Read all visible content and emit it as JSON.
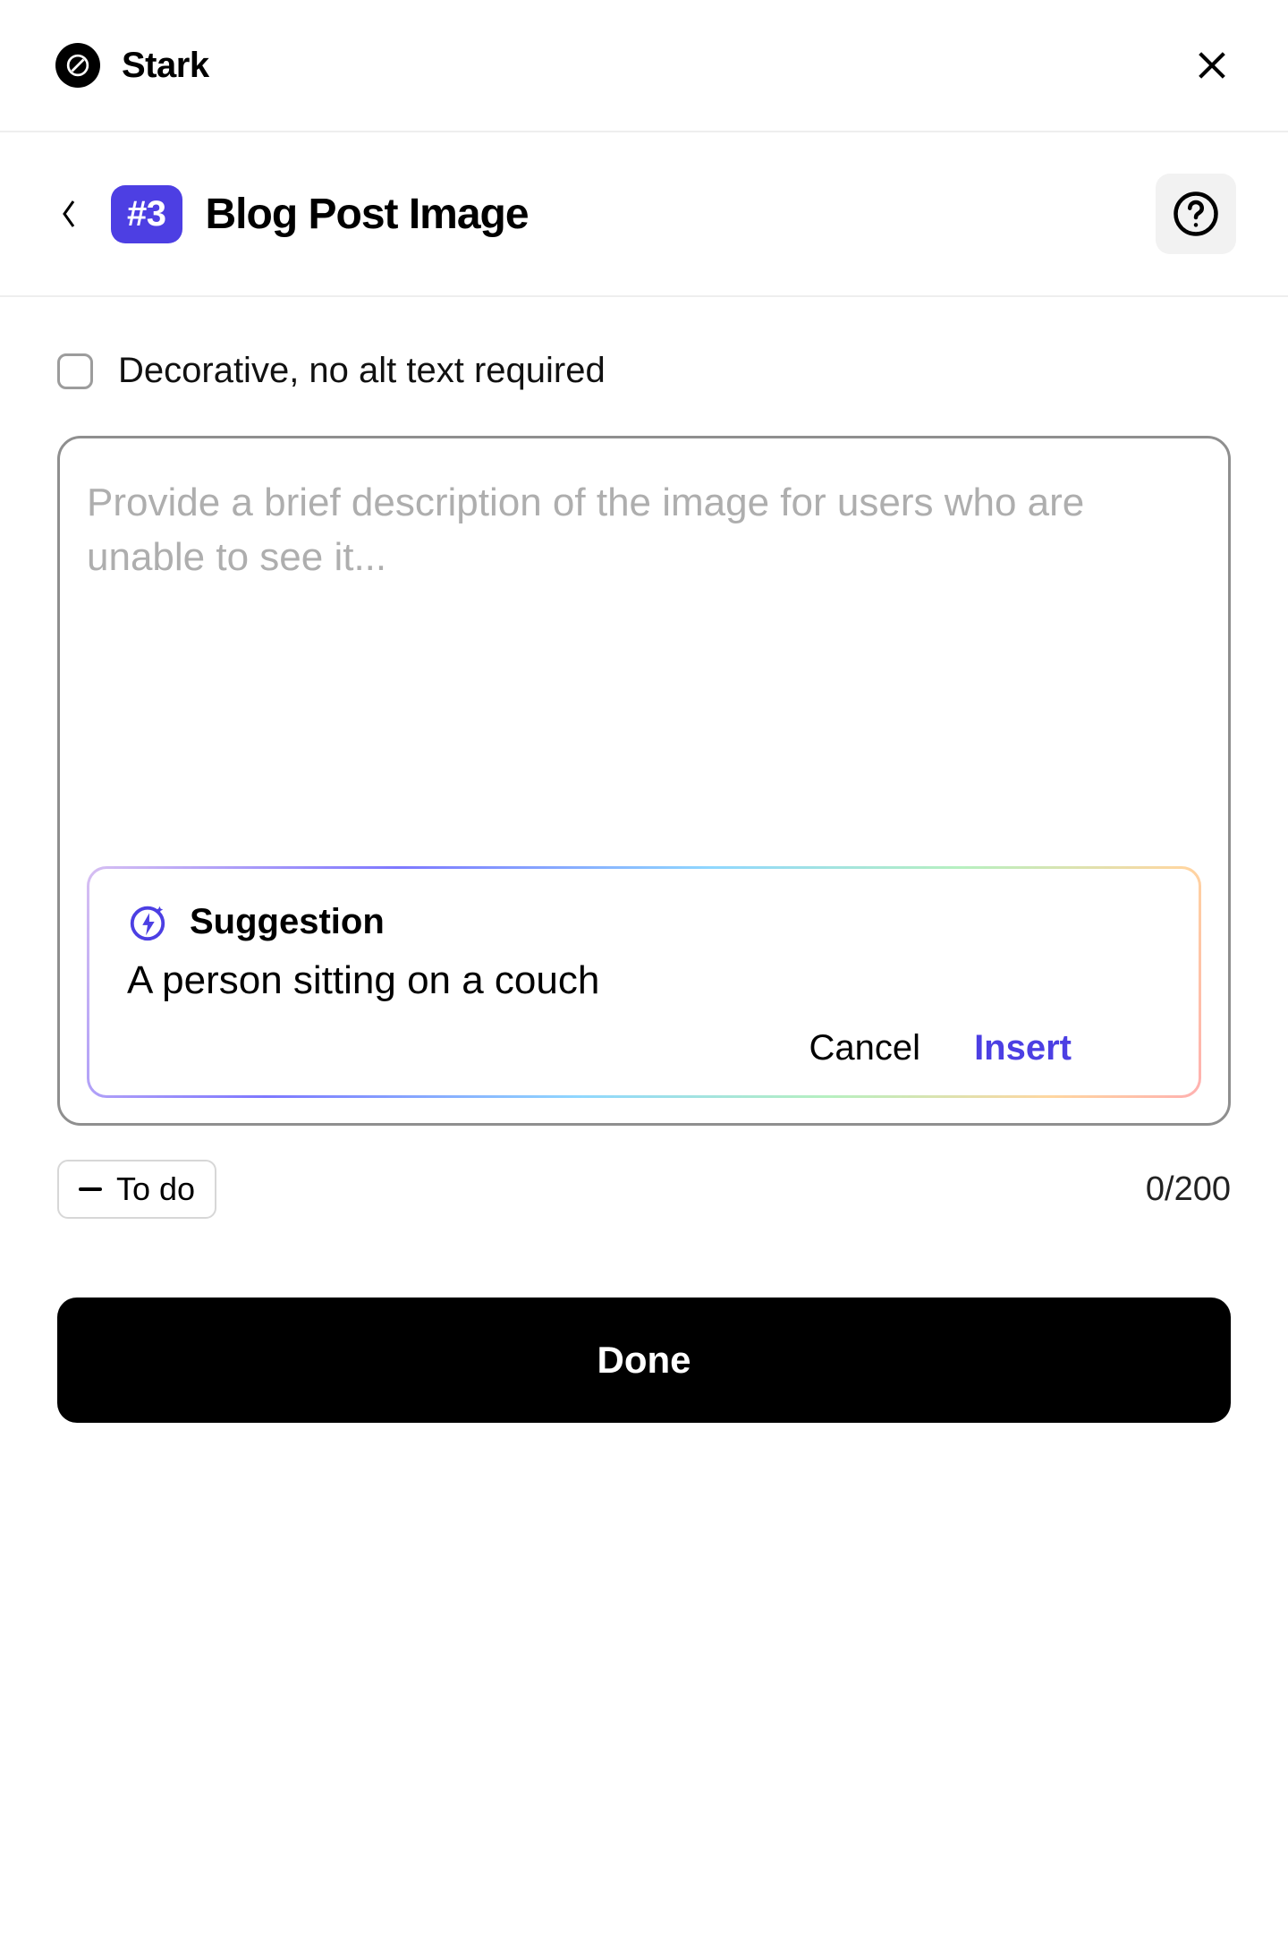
{
  "header": {
    "brand_name": "Stark"
  },
  "page": {
    "badge": "#3",
    "title": "Blog Post Image"
  },
  "form": {
    "decorative_label": "Decorative, no alt text required",
    "decorative_checked": false,
    "alt_text_value": "",
    "alt_text_placeholder": "Provide a brief description of the image for users who are unable to see it...",
    "char_count": "0/200"
  },
  "suggestion": {
    "title": "Suggestion",
    "text": "A person sitting on a couch",
    "cancel_label": "Cancel",
    "insert_label": "Insert"
  },
  "status": {
    "label": "To do"
  },
  "footer": {
    "done_label": "Done"
  },
  "icons": {
    "brand": "stark-logo",
    "close": "close-icon",
    "back": "chevron-left-icon",
    "help": "question-circle-icon",
    "suggestion": "lightning-sparkle-icon"
  },
  "colors": {
    "accent": "#4d3fe3",
    "badge_bg": "#4d3fe3",
    "insert_text": "#4c3fe3"
  }
}
